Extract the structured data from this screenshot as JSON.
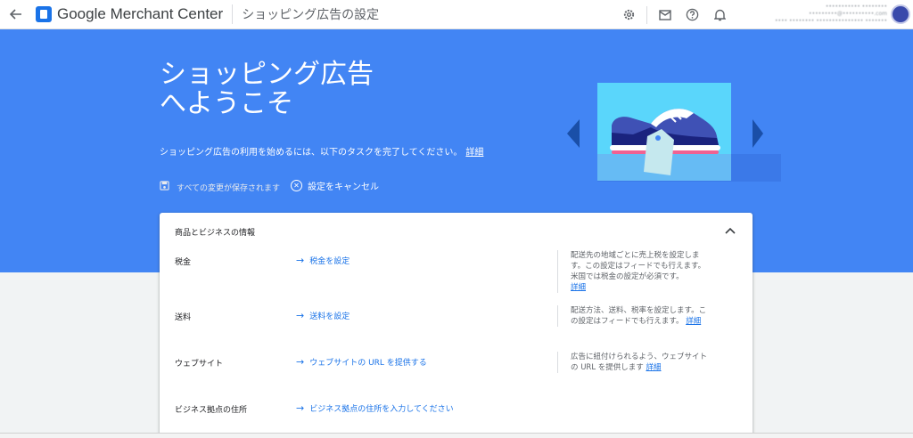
{
  "header": {
    "brand_google": "Google",
    "brand_product": "Merchant Center",
    "page_title": "ショッピング広告の設定",
    "account_lines": [
      "••••••••••• ••••••••",
      "•••••••••@••••••••••.com",
      "•••• •••••••• ••••••••••••••• •••••••"
    ]
  },
  "hero": {
    "title_line1": "ショッピング広告",
    "title_line2": "へようこそ",
    "description": "ショッピング広告の利用を始めるには、以下のタスクを完了してください。",
    "details_link": "詳細",
    "save_status": "すべての変更が保存されます",
    "cancel_label": "設定をキャンセル"
  },
  "card": {
    "title": "商品とビジネスの情報",
    "rows": [
      {
        "label": "税金",
        "link": "税金を設定",
        "help": "配送先の地域ごとに売上税を設定します。この設定はフィードでも行えます。米国では税金の設定が必須です。",
        "help_link": "詳細"
      },
      {
        "label": "送料",
        "link": "送料を設定",
        "help": "配送方法、送料、税率を設定します。この設定はフィードでも行えます。",
        "help_link": "詳細"
      },
      {
        "label": "ウェブサイト",
        "link": "ウェブサイトの URL を提供する",
        "help": "広告に紐付けられるよう、ウェブサイトの URL を提供します",
        "help_link": "詳細"
      },
      {
        "label": "ビジネス拠点の住所",
        "link": "ビジネス拠点の住所を入力してください"
      }
    ]
  },
  "colors": {
    "hero_bg": "#4285f4",
    "link": "#1a73e8",
    "brand_blue": "#1a73e8"
  },
  "icons": {
    "back": "arrow-left-icon",
    "settings": "gear-icon",
    "mail": "mail-icon",
    "help": "help-circle-icon",
    "notifications": "bell-icon",
    "save": "floppy-disk-icon",
    "cancel": "close-circle-icon",
    "link_arrow": "arrow-right-icon",
    "collapse": "chevron-up-icon"
  }
}
